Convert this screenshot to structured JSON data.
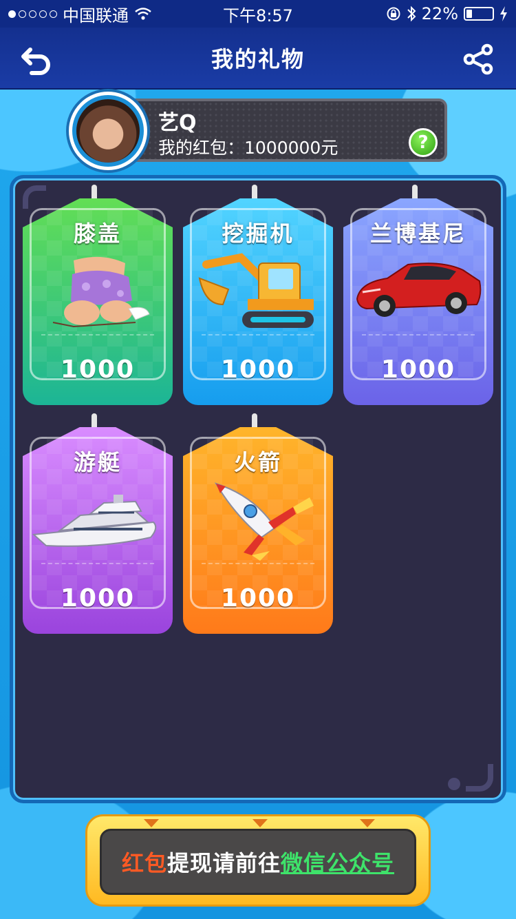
{
  "status_bar": {
    "carrier": "中国联通",
    "time": "下午8:57",
    "battery": "22%"
  },
  "nav": {
    "title": "我的礼物"
  },
  "profile": {
    "name": "艺Q",
    "balance": "我的红包：1000000元",
    "help_glyph": "?"
  },
  "gifts": [
    {
      "name": "膝盖",
      "price": "1000",
      "icon": "knee-icon"
    },
    {
      "name": "挖掘机",
      "price": "1000",
      "icon": "excavator-icon"
    },
    {
      "name": "兰博基尼",
      "price": "1000",
      "icon": "sports-car-icon"
    },
    {
      "name": "游艇",
      "price": "1000",
      "icon": "yacht-icon"
    },
    {
      "name": "火箭",
      "price": "1000",
      "icon": "rocket-icon"
    }
  ],
  "banner": {
    "part1": "红包",
    "part2": "提现请前往",
    "part3": "微信公众号"
  },
  "colors": {
    "nav_bg": "#14308f",
    "panel_bg": "#2d2b46",
    "banner_link": "#3ee36a",
    "banner_red": "#ff5a24"
  }
}
